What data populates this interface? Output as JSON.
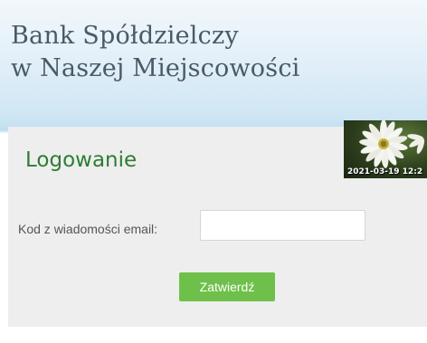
{
  "header": {
    "bank_name_line1": "Bank Spółdzielczy",
    "bank_name_line2": "w Naszej Miejscowości"
  },
  "login": {
    "title": "Logowanie",
    "photo": {
      "icon": "daisy-photo",
      "timestamp": "2021-03-19 12:2"
    },
    "code_field": {
      "label": "Kod z wiadomości email:",
      "value": "",
      "placeholder": ""
    },
    "submit_label": "Zatwierdź"
  },
  "colors": {
    "title_green": "#2e7d32",
    "button_green": "#6ec04a",
    "panel_gray": "#eeeeee",
    "sky_blue": "#cfe6f4"
  }
}
